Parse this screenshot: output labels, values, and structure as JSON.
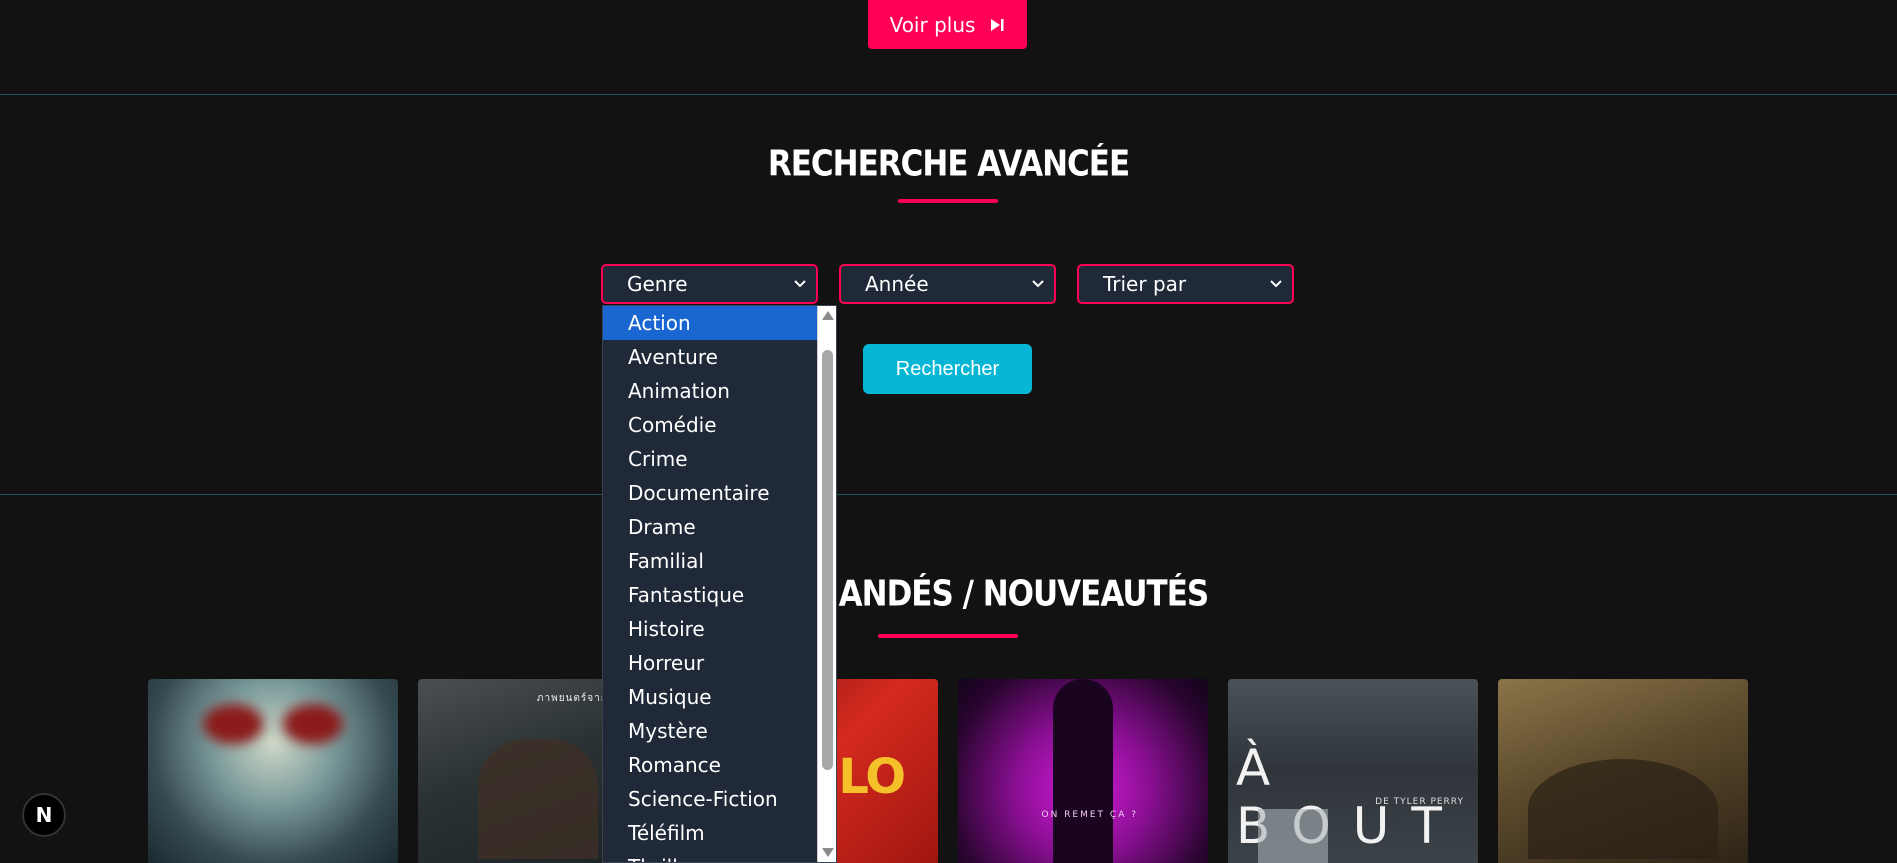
{
  "top_button": {
    "label": "Voir plus"
  },
  "advanced_search": {
    "title": "Recherche avancée",
    "selects": {
      "genre": "Genre",
      "year": "Année",
      "sort": "Trier par"
    },
    "genre_options": [
      "Action",
      "Aventure",
      "Animation",
      "Comédie",
      "Crime",
      "Documentaire",
      "Drame",
      "Familial",
      "Fantastique",
      "Histoire",
      "Horreur",
      "Musique",
      "Mystère",
      "Romance",
      "Science-Fiction",
      "Téléfilm",
      "Thriller"
    ],
    "selected_option": "Action",
    "search_button": "Rechercher"
  },
  "recommended": {
    "title": "Recommandés / Nouveautés",
    "poster_texts": {
      "p2_tag": "ภาพยนตร์จาก NETFLIX",
      "p3_text": "ABLO",
      "p4_text": "ON REMET ÇA ?",
      "p5_text": "À BOUT",
      "p5_sub": "DE TYLER PERRY"
    }
  },
  "badge": {
    "letter": "N"
  },
  "colors": {
    "accent": "#ff0054",
    "button_cyan": "#06b6d4",
    "background": "#121212",
    "select_bg": "#1f2937",
    "option_selected": "#1a66d0"
  }
}
